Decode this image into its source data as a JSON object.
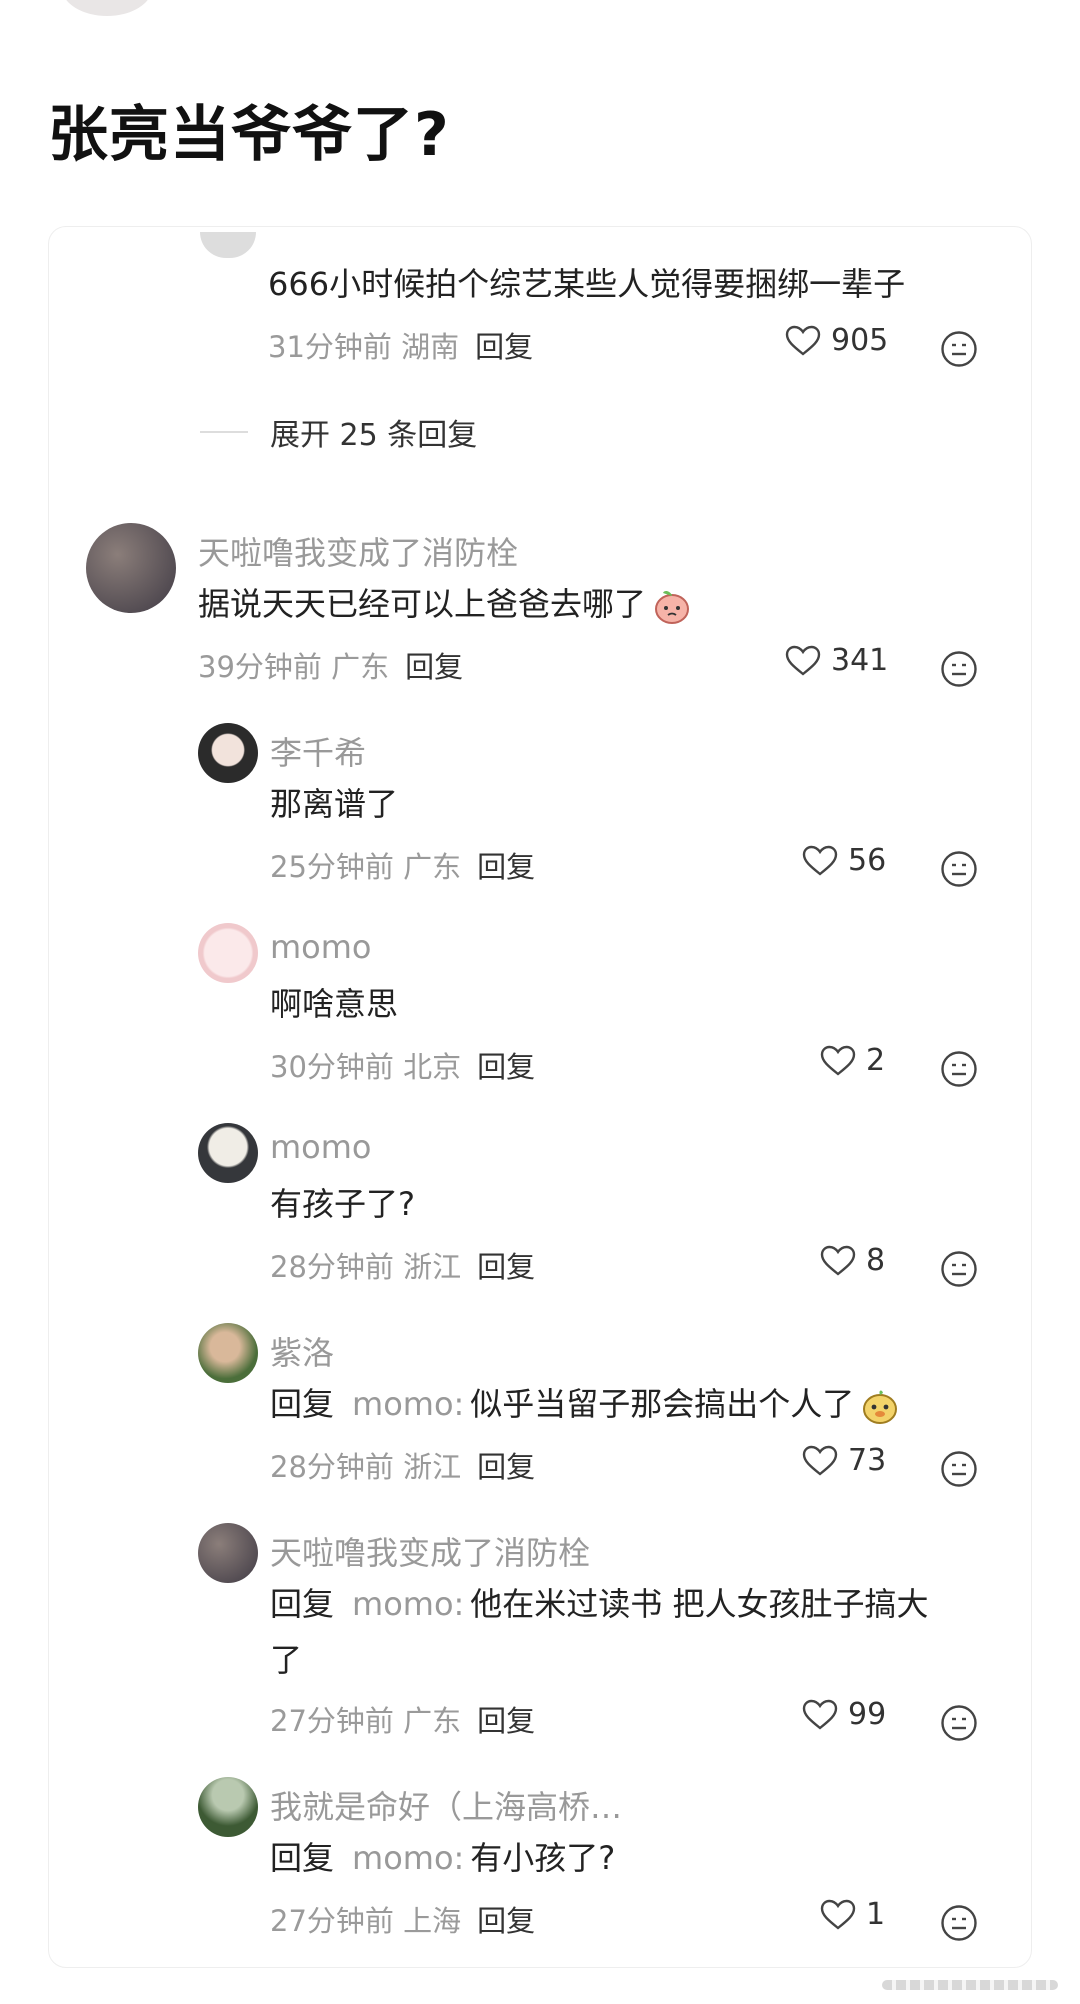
{
  "page": {
    "title": "张亮当爷爷了?"
  },
  "first_comment": {
    "text": "666小时候拍个综艺某些人觉得要捆绑一辈子",
    "time_loc": "31分钟前 湖南",
    "reply_label": "回复",
    "likes": "905"
  },
  "expand_replies": "展开 25 条回复",
  "comments": [
    {
      "user": "天啦噜我变成了消防栓",
      "text": "据说天天已经可以上爸爸去哪了",
      "time_loc": "39分钟前 广东",
      "reply_label": "回复",
      "likes": "341"
    },
    {
      "user": "李千希",
      "text": "那离谱了",
      "time_loc": "25分钟前 广东",
      "reply_label": "回复",
      "likes": "56"
    },
    {
      "user": "momo",
      "text": "啊啥意思",
      "time_loc": "30分钟前 北京",
      "reply_label": "回复",
      "likes": "2"
    },
    {
      "user": "momo",
      "text": "有孩子了?",
      "time_loc": "28分钟前 浙江",
      "reply_label": "回复",
      "likes": "8"
    },
    {
      "user": "紫洛",
      "reply_prefix": "回复",
      "reply_to": "momo:",
      "text": "似乎当留子那会搞出个人了",
      "time_loc": "28分钟前 浙江",
      "reply_label": "回复",
      "likes": "73"
    },
    {
      "user": "天啦噜我变成了消防栓",
      "reply_prefix": "回复",
      "reply_to": "momo:",
      "text": "他在米过读书 把人女孩肚子搞大",
      "text2": "了",
      "time_loc": "27分钟前 广东",
      "reply_label": "回复",
      "likes": "99"
    },
    {
      "user": "我就是命好（上海高桥…",
      "reply_prefix": "回复",
      "reply_to": "momo:",
      "text": "有小孩了?",
      "time_loc": "27分钟前 上海",
      "reply_label": "回复",
      "likes": "1"
    }
  ]
}
